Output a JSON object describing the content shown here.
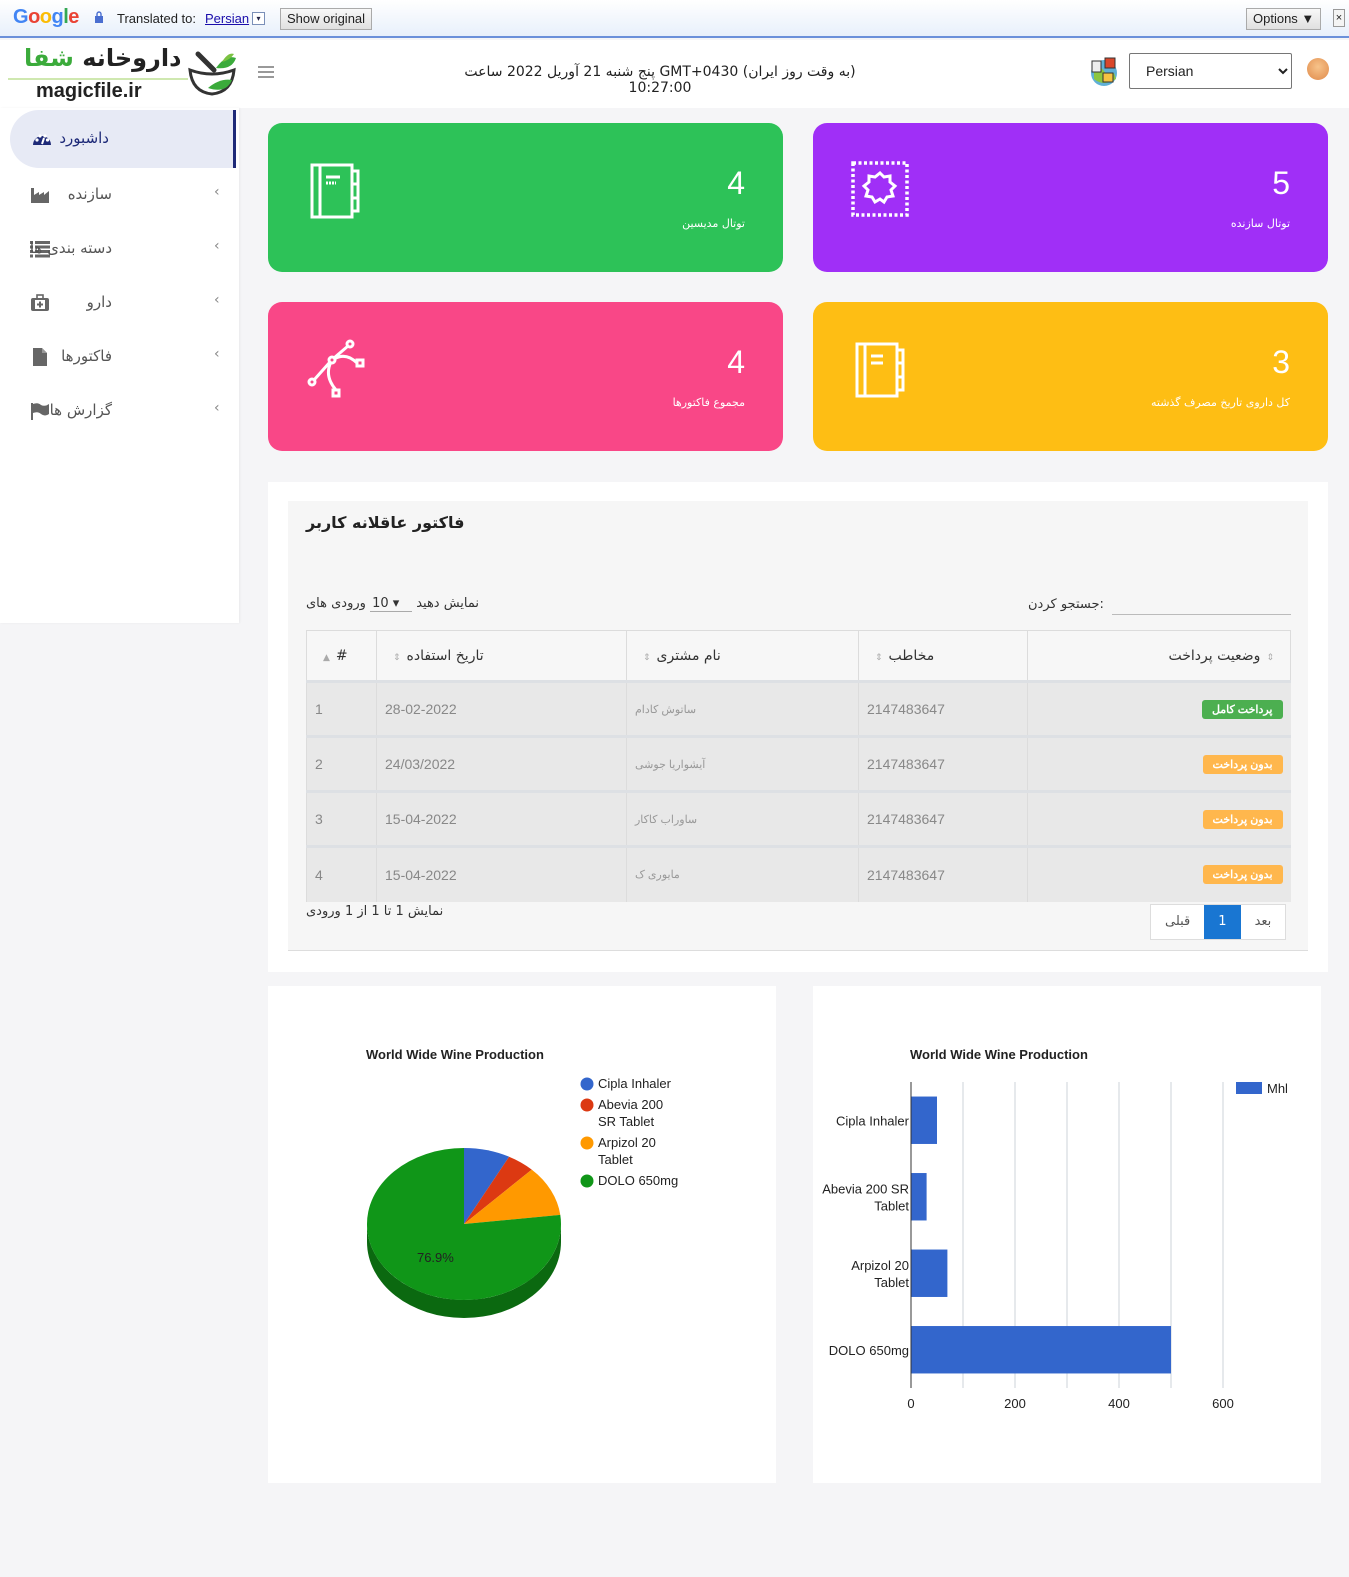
{
  "translate_bar": {
    "brand": "Google",
    "translated_to_label": "Translated to:",
    "language": "Persian",
    "dropdown_glyph": "▾",
    "show_original": "Show original",
    "options": "Options ▼",
    "close_glyph": "×"
  },
  "header": {
    "logo_name_dark": "داروخانه",
    "logo_name_green": "شفا",
    "logo_site": "magicfile.ir",
    "clock_text": "(به وقت روز ایران) GMT+0430 پنج شنبه 21 آوریل 2022 ساعت 10:27:00",
    "language_select": "Persian"
  },
  "sidebar": {
    "items": [
      {
        "label": "داشبورد",
        "icon": "dashboard-icon",
        "active": true
      },
      {
        "label": "سازنده",
        "icon": "factory-icon"
      },
      {
        "label": "دسته بندی ها",
        "icon": "list-icon"
      },
      {
        "label": "دارو",
        "icon": "medkit-icon"
      },
      {
        "label": "فاکتورها",
        "icon": "file-icon"
      },
      {
        "label": "گزارش ها",
        "icon": "flag-icon"
      }
    ],
    "chevron": "›"
  },
  "cards": [
    {
      "value": "4",
      "label": "توتال مدیسین",
      "color": "#2dc258",
      "icon": "notebook-icon"
    },
    {
      "value": "5",
      "label": "توتال سازنده",
      "color": "#a02ff7",
      "icon": "gear-icon"
    },
    {
      "value": "4",
      "label": "مجموع فاکتورها",
      "color": "#f94787",
      "icon": "vector-path-icon"
    },
    {
      "value": "3",
      "label": "کل داروی تاریخ مصرف گذشته",
      "color": "#febe14",
      "icon": "notebook-icon"
    }
  ],
  "invoices": {
    "title": "فاکتور عاقلانه کاربر",
    "length_prefix": "نمایش دهید",
    "length_value": "10",
    "length_suffix": "ورودی های",
    "search_label": ":جستجو کردن",
    "search_value": "",
    "columns": [
      "#",
      "تاریخ استفاده",
      "نام مشتری",
      "مخاطب",
      "وضعیت پرداخت"
    ],
    "rows": [
      {
        "id": "1",
        "date": "28-02-2022",
        "customer": "ساتوش کادام",
        "contact": "2147483647",
        "status": "پرداخت کامل",
        "status_color": "#4caf50"
      },
      {
        "id": "2",
        "date": "24/03/2022",
        "customer": "آیشواریا جوشی",
        "contact": "2147483647",
        "status": "بدون پرداخت",
        "status_color": "#ffb74d"
      },
      {
        "id": "3",
        "date": "15-04-2022",
        "customer": "ساوراب کاکار",
        "contact": "2147483647",
        "status": "بدون پرداخت",
        "status_color": "#ffb74d"
      },
      {
        "id": "4",
        "date": "15-04-2022",
        "customer": "مایوری ک",
        "contact": "2147483647",
        "status": "بدون پرداخت",
        "status_color": "#ffb74d"
      }
    ],
    "info": "نمایش 1 تا 1 از 1 ورودی",
    "pager": {
      "next": "بعد",
      "current": "1",
      "prev": "قبلی"
    }
  },
  "chart_data": [
    {
      "type": "pie",
      "title": "World Wide Wine Production",
      "categories": [
        "Cipla Inhaler",
        "Abevia 200 SR Tablet",
        "Arpizol 20 Tablet",
        "DOLO 650mg"
      ],
      "legend_lines": [
        [
          "Cipla Inhaler"
        ],
        [
          "Abevia 200",
          "SR Tablet"
        ],
        [
          "Arpizol 20",
          "Tablet"
        ],
        [
          "DOLO 650mg"
        ]
      ],
      "values": [
        50,
        30,
        70,
        500
      ],
      "colors": [
        "#3366cc",
        "#dc3912",
        "#ff9900",
        "#109618"
      ],
      "slice_labels": [
        "",
        "",
        "",
        "76.9%"
      ],
      "legend": "right",
      "is3D": true
    },
    {
      "type": "bar",
      "orientation": "horizontal",
      "title": "World Wide Wine Production",
      "categories": [
        "Cipla Inhaler",
        "Abevia 200 SR Tablet",
        "Arpizol 20 Tablet",
        "DOLO 650mg"
      ],
      "category_lines": [
        [
          "Cipla Inhaler"
        ],
        [
          "Abevia 200 SR",
          "Tablet"
        ],
        [
          "Arpizol 20",
          "Tablet"
        ],
        [
          "DOLO 650mg"
        ]
      ],
      "series": [
        {
          "name": "Mhl",
          "values": [
            50,
            30,
            70,
            500
          ],
          "color": "#3366cc"
        }
      ],
      "xticks": [
        "0",
        "200",
        "400",
        "600"
      ],
      "xlim": [
        0,
        600
      ],
      "grid": true,
      "legend": "top-right"
    }
  ]
}
